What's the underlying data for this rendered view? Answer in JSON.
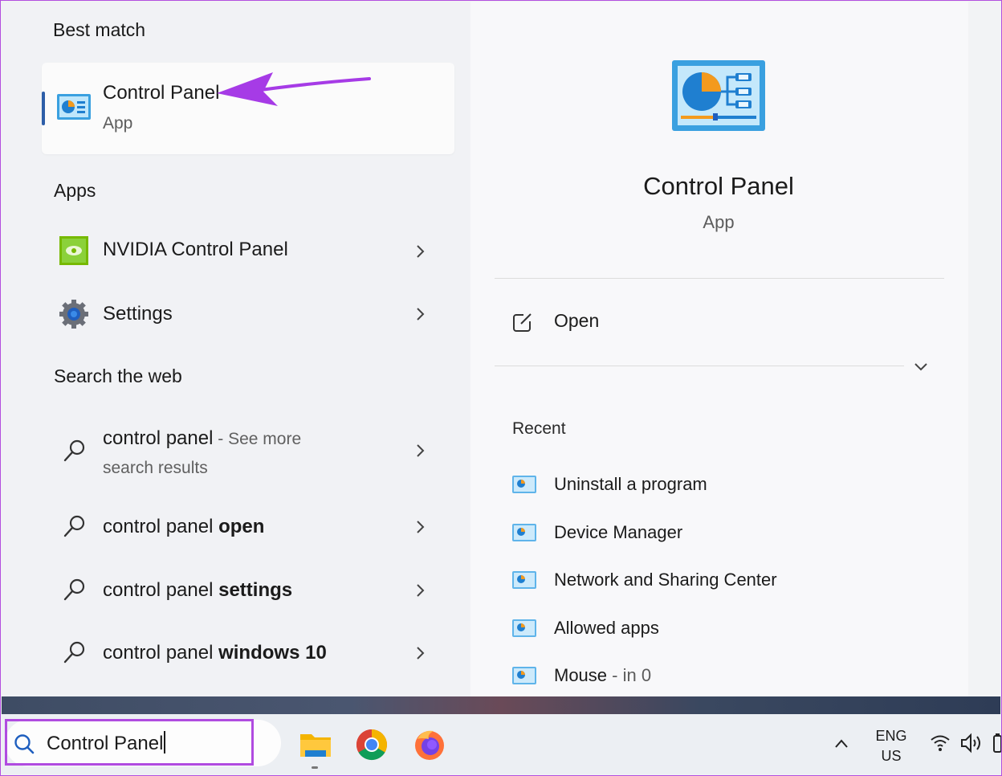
{
  "best_match": {
    "heading": "Best match",
    "title": "Control Panel",
    "subtitle": "App"
  },
  "apps": {
    "heading": "Apps",
    "items": [
      {
        "label": "NVIDIA Control Panel",
        "icon": "nvidia-icon"
      },
      {
        "label": "Settings",
        "icon": "gear-icon"
      }
    ]
  },
  "web": {
    "heading": "Search the web",
    "items": [
      {
        "prefix": "control panel",
        "suffix": " - See more",
        "line2": "search results"
      },
      {
        "prefix": "control panel ",
        "bold": "open"
      },
      {
        "prefix": "control panel ",
        "bold": "settings"
      },
      {
        "prefix": "control panel ",
        "bold": "windows 10"
      }
    ]
  },
  "detail": {
    "title": "Control Panel",
    "subtitle": "App",
    "open_label": "Open",
    "recent_heading": "Recent",
    "recent": [
      {
        "label": "Uninstall a program"
      },
      {
        "label": "Device Manager"
      },
      {
        "label": "Network and Sharing Center"
      },
      {
        "label": "Allowed apps"
      },
      {
        "label": "Mouse",
        "suffix": " - in 0"
      }
    ]
  },
  "taskbar": {
    "search_value": "Control Panel",
    "apps": [
      "file-explorer-icon",
      "chrome-icon",
      "firefox-icon"
    ],
    "lang_line1": "ENG",
    "lang_line2": "US"
  },
  "colors": {
    "highlight": "#b04be0",
    "accent": "#2d5ea8"
  }
}
